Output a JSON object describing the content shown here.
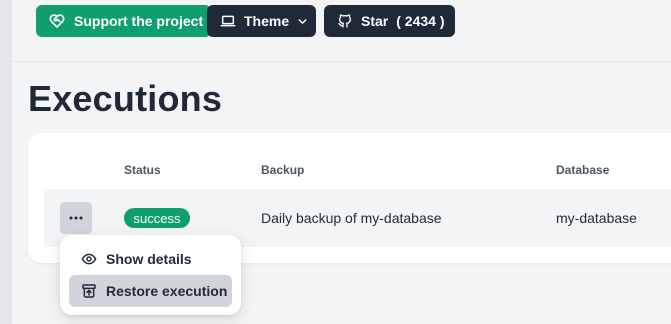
{
  "header": {
    "support_label": "Support the project",
    "theme_label": "Theme",
    "star_label": "Star",
    "star_count": "( 2434 )"
  },
  "page": {
    "title": "Executions"
  },
  "table": {
    "columns": [
      "Status",
      "Backup",
      "Database"
    ],
    "rows": [
      {
        "status": "success",
        "backup": "Daily backup of my-database",
        "database": "my-database"
      }
    ]
  },
  "menu": {
    "items": [
      {
        "label": "Show details",
        "icon": "eye-icon"
      },
      {
        "label": "Restore execution",
        "icon": "restore-icon"
      }
    ]
  },
  "colors": {
    "accent_green": "#0f9f6e",
    "dark_button": "#1f2937"
  }
}
